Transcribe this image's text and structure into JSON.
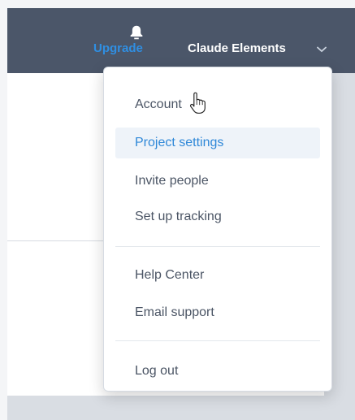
{
  "header": {
    "upgrade_label": "Upgrade",
    "user_name": "Claude Elements",
    "icons": [
      "bell-icon",
      "chevron-down-icon"
    ]
  },
  "menu": {
    "items": [
      {
        "label": "Account"
      },
      {
        "label": "Project settings",
        "active": true
      },
      {
        "label": "Invite people"
      },
      {
        "label": "Set up tracking"
      },
      {
        "label": "Help Center"
      },
      {
        "label": "Email support"
      },
      {
        "label": "Log out"
      }
    ]
  },
  "colors": {
    "topbar": "#4b5669",
    "accent": "#2f88d8",
    "menu_text": "#4b5565",
    "active_bg": "#eef3f9",
    "background": "#d9dde3"
  }
}
